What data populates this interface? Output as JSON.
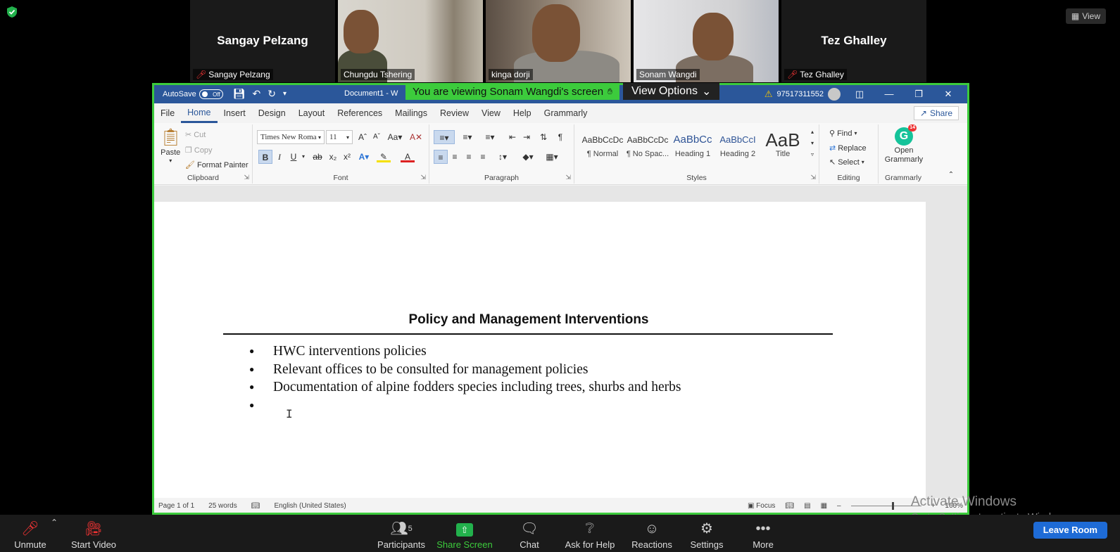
{
  "zoom": {
    "view_label": "View",
    "viewing_banner": "You are viewing Sonam Wangdi's screen",
    "view_options_label": "View Options",
    "participants": [
      {
        "display": "Sangay Pelzang",
        "label": "Sangay Pelzang",
        "muted": true,
        "video": false
      },
      {
        "display": "",
        "label": "Chungdu Tshering",
        "muted": false,
        "video": true
      },
      {
        "display": "",
        "label": "kinga dorji",
        "muted": false,
        "video": true
      },
      {
        "display": "",
        "label": "Sonam Wangdi",
        "muted": false,
        "video": true,
        "active": true
      },
      {
        "display": "Tez Ghalley",
        "label": "Tez Ghalley",
        "muted": true,
        "video": false
      }
    ],
    "toolbar": {
      "unmute": "Unmute",
      "start_video": "Start Video",
      "participants": "Participants",
      "participants_count": "5",
      "share_screen": "Share Screen",
      "chat": "Chat",
      "ask_for_help": "Ask for Help",
      "reactions": "Reactions",
      "settings": "Settings",
      "more": "More",
      "leave_room": "Leave Room"
    },
    "watermark": {
      "line1": "Activate Windows",
      "line2": "Go to Settings to activate Windows."
    },
    "colors": {
      "accent_green": "#3ccb3c",
      "leave_blue": "#1e6bd6",
      "word_blue": "#2b579a"
    }
  },
  "word": {
    "autosave_label": "AutoSave",
    "autosave_state": "Off",
    "doc_title": "Document1 - W",
    "account": "97517311552",
    "tabs": [
      "File",
      "Home",
      "Insert",
      "Design",
      "Layout",
      "References",
      "Mailings",
      "Review",
      "View",
      "Help",
      "Grammarly"
    ],
    "share_label": "Share",
    "clipboard": {
      "paste": "Paste",
      "cut": "Cut",
      "copy": "Copy",
      "format_painter": "Format Painter",
      "group": "Clipboard"
    },
    "font": {
      "name": "Times New Roma",
      "size": "11",
      "group": "Font",
      "case_label": "Aa"
    },
    "paragraph": {
      "group": "Paragraph"
    },
    "styles": {
      "group": "Styles",
      "items": [
        {
          "sample": "AaBbCcDc",
          "name": "¶ Normal"
        },
        {
          "sample": "AaBbCcDc",
          "name": "¶ No Spac..."
        },
        {
          "sample": "AaBbCc",
          "name": "Heading 1"
        },
        {
          "sample": "AaBbCcI",
          "name": "Heading 2"
        },
        {
          "sample": "AaB",
          "name": "Title"
        }
      ]
    },
    "editing": {
      "find": "Find",
      "replace": "Replace",
      "select": "Select",
      "group": "Editing"
    },
    "grammarly": {
      "open": "Open",
      "name": "Grammarly",
      "group": "Grammarly",
      "badge": "14"
    },
    "document": {
      "heading": "Policy and Management Interventions",
      "bullets": [
        "HWC interventions policies",
        "Relevant offices to be consulted for management policies",
        "Documentation of alpine fodders species including trees, shurbs and herbs",
        ""
      ]
    },
    "status": {
      "page": "Page 1 of 1",
      "words": "25 words",
      "language": "English (United States)",
      "focus": "Focus",
      "zoom": "160%"
    }
  }
}
